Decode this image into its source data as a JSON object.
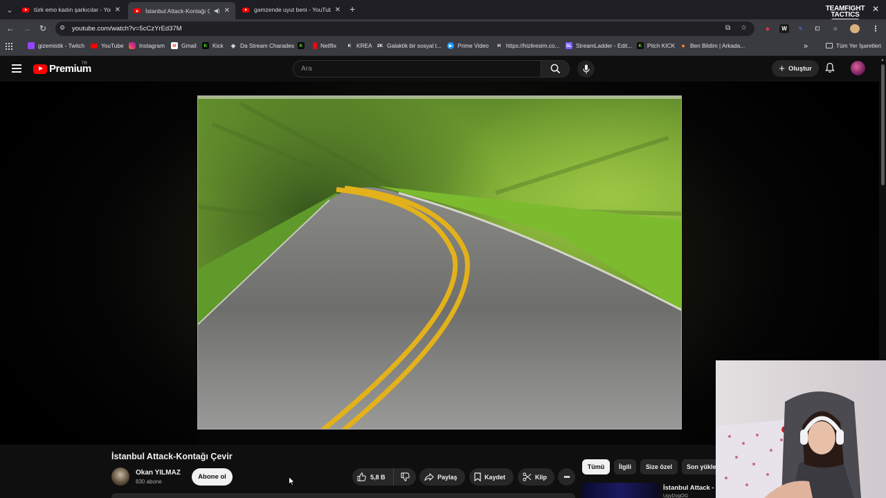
{
  "browser": {
    "tabs": [
      {
        "title": "türk emo kadın şarkıcılar - YouT",
        "active": false
      },
      {
        "title": "İstanbul Attack-Kontağı Çevir",
        "active": true
      },
      {
        "title": "gamzende uyut beni - YouTube",
        "active": false
      }
    ],
    "overlay_logo": {
      "line1": "TEAMFIGHT",
      "line2": "TACTICS"
    },
    "url": "youtube.com/watch?v=5cCzYrEd37M",
    "bookmarks": [
      {
        "label": "gizemistik - Twitch",
        "icon": "twitch-icon",
        "color": "#9146ff"
      },
      {
        "label": "YouTube",
        "icon": "youtube-icon",
        "color": "#ff0000"
      },
      {
        "label": "Instagram",
        "icon": "instagram-icon",
        "color": "#e1306c"
      },
      {
        "label": "Gmail",
        "icon": "gmail-icon",
        "color": "#ea4335"
      },
      {
        "label": "Kick",
        "icon": "kick-icon",
        "color": "#53fc18"
      },
      {
        "label": "Da Stream Charades",
        "icon": "puzzle-icon",
        "color": "#d0d0d0"
      },
      {
        "label": "",
        "icon": "kick-icon",
        "color": "#53fc18"
      },
      {
        "label": "Netflix",
        "icon": "netflix-icon",
        "color": "#e50914"
      },
      {
        "label": "KREA",
        "icon": "krea-icon",
        "color": "#ffffff"
      },
      {
        "label": "Galaktik bir sosyal t...",
        "icon": "galaktik-icon",
        "color": "#ffffff"
      },
      {
        "label": "Prime Video",
        "icon": "prime-video-icon",
        "color": "#1a98ff"
      },
      {
        "label": "https://hizliresim.co...",
        "icon": "hizliresim-icon",
        "color": "#ffffff"
      },
      {
        "label": "StreamLadder - Edit...",
        "icon": "streamladder-icon",
        "color": "#7b5cff"
      },
      {
        "label": "Pitch KICK",
        "icon": "kick-icon",
        "color": "#53fc18"
      },
      {
        "label": "Ben Bildim | Arkada...",
        "icon": "benbildim-icon",
        "color": "#ff8c1a"
      }
    ],
    "all_bookmarks_label": "Tüm Yer İşaretleri"
  },
  "youtube": {
    "logo_text": "Premium",
    "region": "TR",
    "search_placeholder": "Ara",
    "create_label": "Oluştur",
    "video": {
      "title": "İstanbul Attack-Kontağı Çevir",
      "channel": "Okan YILMAZ",
      "subscribers": "830 abone",
      "subscribe_label": "Abone ol",
      "likes": "5,8 B",
      "share_label": "Paylaş",
      "save_label": "Kaydet",
      "clip_label": "Klip"
    },
    "chips": [
      "Tümü",
      "İlgili",
      "Size özel",
      "Son yüklen"
    ],
    "recommendation": {
      "title": "İstanbul Attack - E",
      "channel": "UgyDogOG"
    }
  },
  "colors": {
    "brand": "#ff0000",
    "accent_tab": "#3a3a41"
  }
}
